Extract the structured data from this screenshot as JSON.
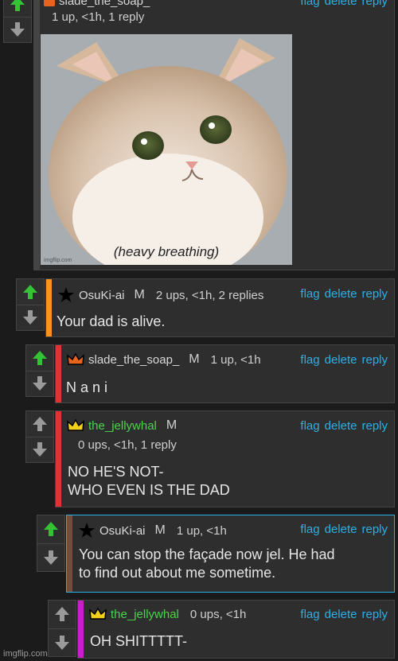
{
  "top_comment": {
    "username": "slade_the_soap_",
    "stats": "1 up, <1h, 1 reply",
    "image_caption": "(heavy breathing)",
    "image_small_text": "imgflip.com"
  },
  "actions": {
    "flag": "flag",
    "delete": "delete",
    "reply": "reply"
  },
  "comments": [
    {
      "username": "OsuKi-ai",
      "mod": "M",
      "stats": "2 ups, <1h, 2 replies",
      "text": "Your dad is alive.",
      "bar_color": "#f7931e",
      "badge": "star-icon"
    },
    {
      "username": "slade_the_soap_",
      "mod": "M",
      "stats": "1 up, <1h",
      "text": "N a n i",
      "bar_color": "#e03232",
      "badge": "orange-crown-icon"
    },
    {
      "username": "the_jellywhal",
      "mod": "M",
      "stats": "0 ups, <1h, 1 reply",
      "text": "NO HE'S NOT-\nWHO EVEN IS THE DAD",
      "bar_color": "#e03232",
      "badge": "yellow-crown-icon"
    },
    {
      "username": "OsuKi-ai",
      "mod": "M",
      "stats": "1 up, <1h",
      "text": "You can stop the façade now jel. He had\nto find out about me sometime.",
      "bar_color": "#7a4a3a",
      "badge": "star-icon"
    },
    {
      "username": "the_jellywhal",
      "mod": "",
      "stats": "0 ups, <1h",
      "text": "OH SHITTTTT-",
      "bar_color": "#c81fc8",
      "badge": "yellow-crown-icon"
    }
  ],
  "watermark": "imgflip.com"
}
